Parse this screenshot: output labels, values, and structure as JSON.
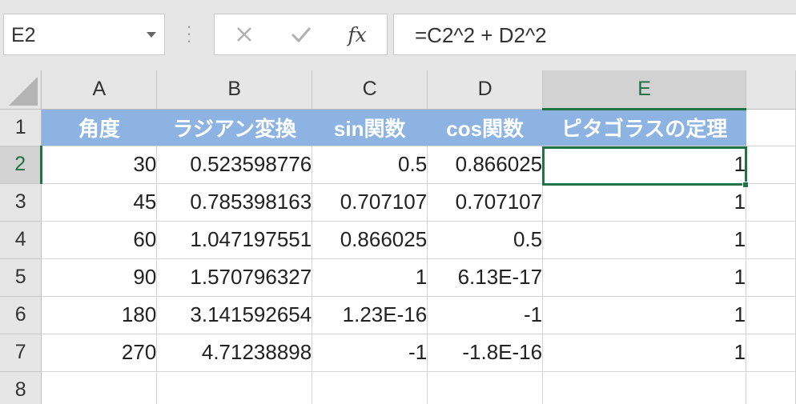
{
  "namebox": {
    "value": "E2"
  },
  "formula_bar": {
    "cancel_symbol": "✕",
    "enter_symbol": "✓",
    "fx_label": "fx",
    "formula": "=C2^2 + D2^2"
  },
  "columns": [
    "A",
    "B",
    "C",
    "D",
    "E"
  ],
  "rows": [
    "1",
    "2",
    "3",
    "4",
    "5",
    "6",
    "7",
    "8"
  ],
  "header_row": [
    "角度",
    "ラジアン変換",
    "sin関数",
    "cos関数",
    "ピタゴラスの定理"
  ],
  "data_rows": [
    [
      "30",
      "0.523598776",
      "0.5",
      "0.866025",
      "1"
    ],
    [
      "45",
      "0.785398163",
      "0.707107",
      "0.707107",
      "1"
    ],
    [
      "60",
      "1.047197551",
      "0.866025",
      "0.5",
      "1"
    ],
    [
      "90",
      "1.570796327",
      "1",
      "6.13E-17",
      "1"
    ],
    [
      "180",
      "3.141592654",
      "1.23E-16",
      "-1",
      "1"
    ],
    [
      "270",
      "4.71238898",
      "-1",
      "-1.8E-16",
      "1"
    ]
  ],
  "colors": {
    "header_fill": "#8db3e2",
    "selection": "#217346"
  }
}
